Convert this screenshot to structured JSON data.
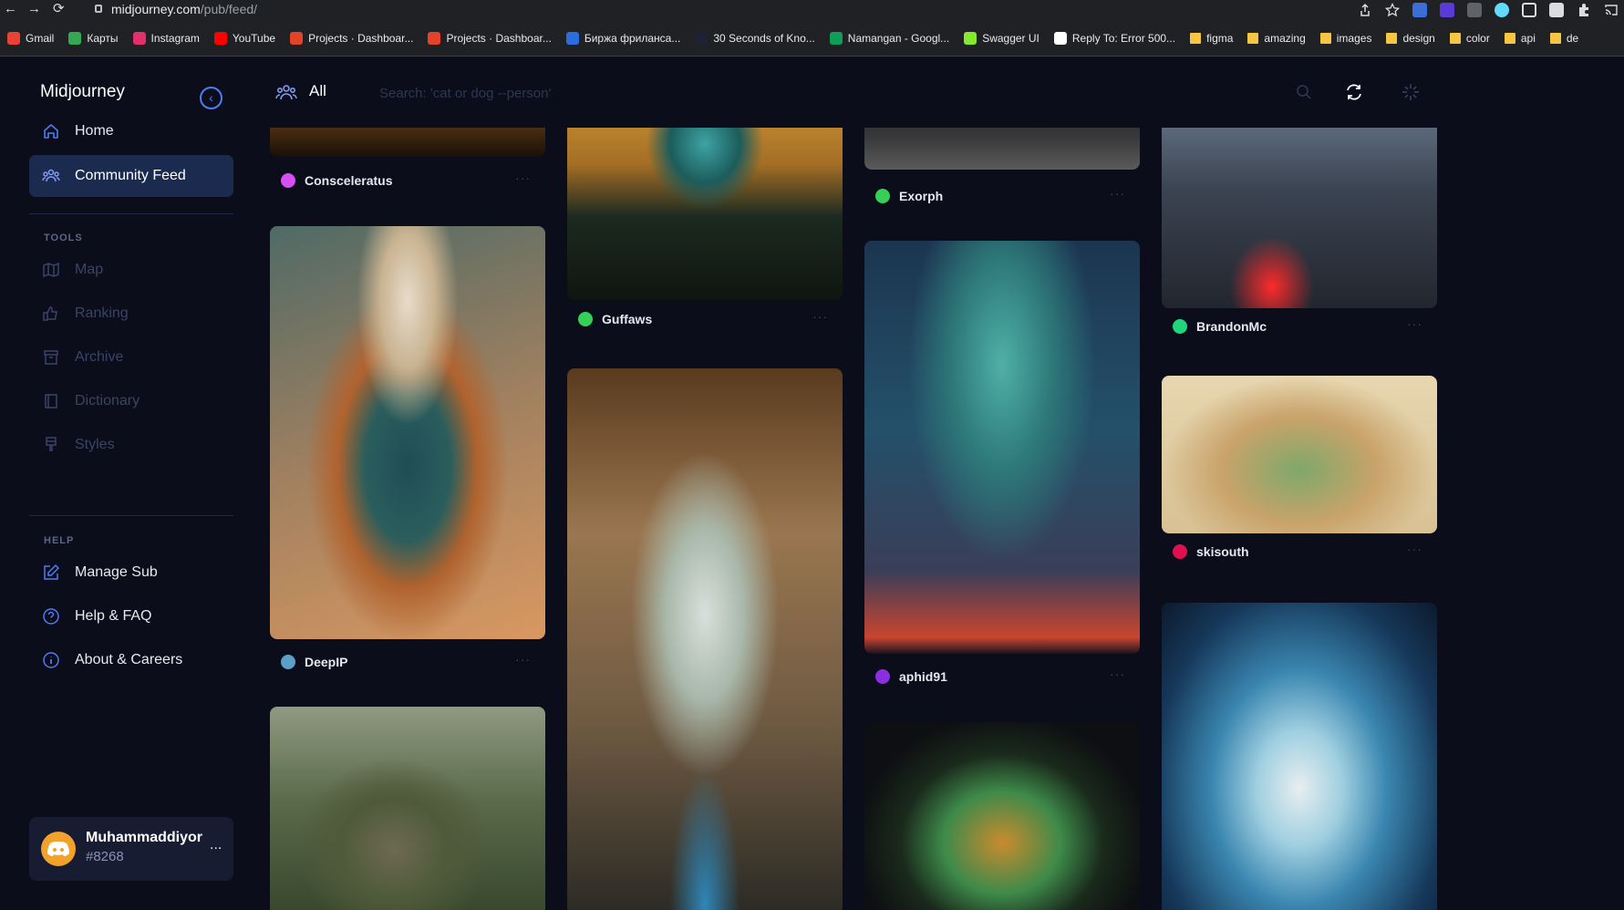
{
  "browser": {
    "url_host": "midjourney.com",
    "url_path": "/pub/feed/",
    "bookmarks": [
      {
        "label": "Gmail",
        "color": "#ea4335"
      },
      {
        "label": "Карты",
        "color": "#34a853"
      },
      {
        "label": "Instagram",
        "color": "#e1306c"
      },
      {
        "label": "YouTube",
        "color": "#ff0000"
      },
      {
        "label": "Projects · Dashboar...",
        "color": "#e24329"
      },
      {
        "label": "Projects · Dashboar...",
        "color": "#e24329"
      },
      {
        "label": "Биржа фриланса...",
        "color": "#2b6cde"
      },
      {
        "label": "30 Seconds of Kno...",
        "color": "#1e2333"
      },
      {
        "label": "Namangan - Googl...",
        "color": "#0f9d58"
      },
      {
        "label": "Swagger UI",
        "color": "#85ea2d"
      },
      {
        "label": "Reply To: Error 500...",
        "color": "#ffffff"
      },
      {
        "label": "figma",
        "folder": true
      },
      {
        "label": "amazing",
        "folder": true
      },
      {
        "label": "images",
        "folder": true
      },
      {
        "label": "design",
        "folder": true
      },
      {
        "label": "color",
        "folder": true
      },
      {
        "label": "api",
        "folder": true
      },
      {
        "label": "de",
        "folder": true
      }
    ]
  },
  "sidebar": {
    "brand": "Midjourney",
    "nav": [
      {
        "label": "Home",
        "icon": "home-icon"
      },
      {
        "label": "Community Feed",
        "icon": "community-icon",
        "active": true
      }
    ],
    "tools_label": "TOOLS",
    "tools": [
      {
        "label": "Map",
        "icon": "map-icon"
      },
      {
        "label": "Ranking",
        "icon": "thumbs-up-icon"
      },
      {
        "label": "Archive",
        "icon": "archive-icon"
      },
      {
        "label": "Dictionary",
        "icon": "book-icon"
      },
      {
        "label": "Styles",
        "icon": "brush-icon"
      }
    ],
    "help_label": "HELP",
    "help": [
      {
        "label": "Manage Sub",
        "icon": "edit-icon"
      },
      {
        "label": "Help & FAQ",
        "icon": "question-icon"
      },
      {
        "label": "About & Careers",
        "icon": "info-icon"
      }
    ],
    "user": {
      "name": "Muhammaddiyor",
      "tag": "#8268",
      "menu": "..."
    }
  },
  "header": {
    "feed_label": "All",
    "search_placeholder": "Search: 'cat or dog --person'"
  },
  "posts": [
    {
      "user": "Consceleratus",
      "dot_color": "#d64ff0"
    },
    {
      "user": "DeepIP",
      "dot_color": "#5aa0c8"
    },
    {
      "user": "Guffaws",
      "dot_color": "#34d058"
    },
    {
      "user": "Exorph",
      "dot_color": "#34d058"
    },
    {
      "user": "aphid91",
      "dot_color": "#8b2ee0"
    },
    {
      "user": "BrandonMc",
      "dot_color": "#1fd67a"
    },
    {
      "user": "skisouth",
      "dot_color": "#e0104f"
    }
  ],
  "more_label": "···"
}
